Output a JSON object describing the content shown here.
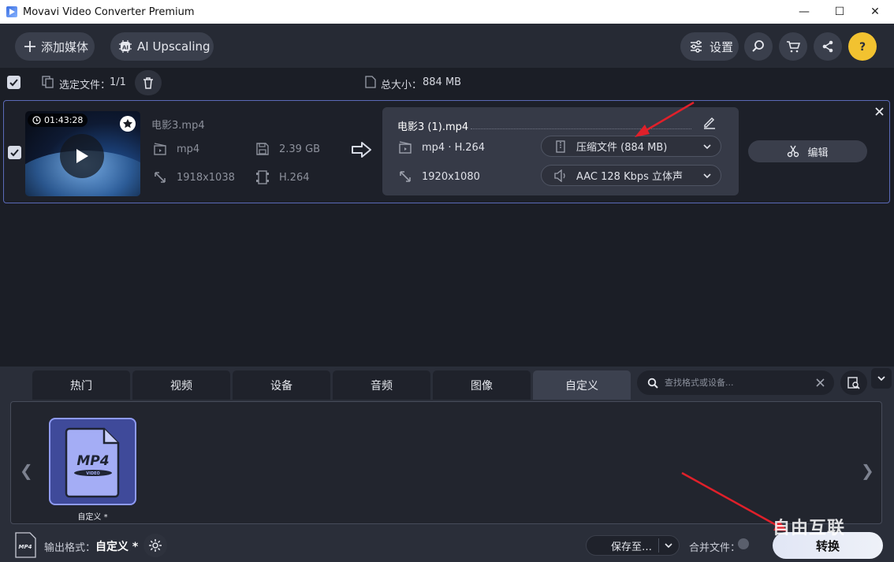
{
  "window": {
    "title": "Movavi Video Converter Premium",
    "minimize": "—",
    "maximize": "☐",
    "close": "✕"
  },
  "toolbar": {
    "add_media_label": "添加媒体",
    "ai_upscaling_label": "AI Upscaling",
    "settings_label": "设置"
  },
  "selection": {
    "selected_files_label": "选定文件：",
    "selected_files_value": "1/1",
    "total_size_label": "总大小：",
    "total_size_value": "884 MB"
  },
  "file": {
    "duration": "01:43:28",
    "source_name": "电影3.mp4",
    "source_container": "mp4",
    "source_size": "2.39 GB",
    "source_resolution": "1918x1038",
    "source_codec": "H.264",
    "output_name": "电影3 (1).mp4",
    "output_format": "mp4 · H.264",
    "output_resolution": "1920x1080",
    "compress_label": "压缩文件 (884 MB)",
    "audio_label": "AAC 128 Kbps 立体声",
    "edit_label": "编辑"
  },
  "tabs": [
    {
      "label": "热门"
    },
    {
      "label": "视频"
    },
    {
      "label": "设备"
    },
    {
      "label": "音频"
    },
    {
      "label": "图像"
    },
    {
      "label": "自定义"
    }
  ],
  "search": {
    "placeholder": "查找格式或设备..."
  },
  "formats": {
    "card_title": "MP4",
    "card_sub": "VIDEO",
    "card_label": "自定义 *"
  },
  "bottom": {
    "output_format_label": "输出格式：",
    "output_format_value": "自定义 *",
    "save_to_label": "保存至…",
    "merge_label": "合并文件：",
    "convert_label": "转换",
    "watermark": "自由互联"
  },
  "colors": {
    "accent": "#5b6ab8",
    "card_fill": "#3f4a9a",
    "annotation_arrow": "#e0202a"
  }
}
